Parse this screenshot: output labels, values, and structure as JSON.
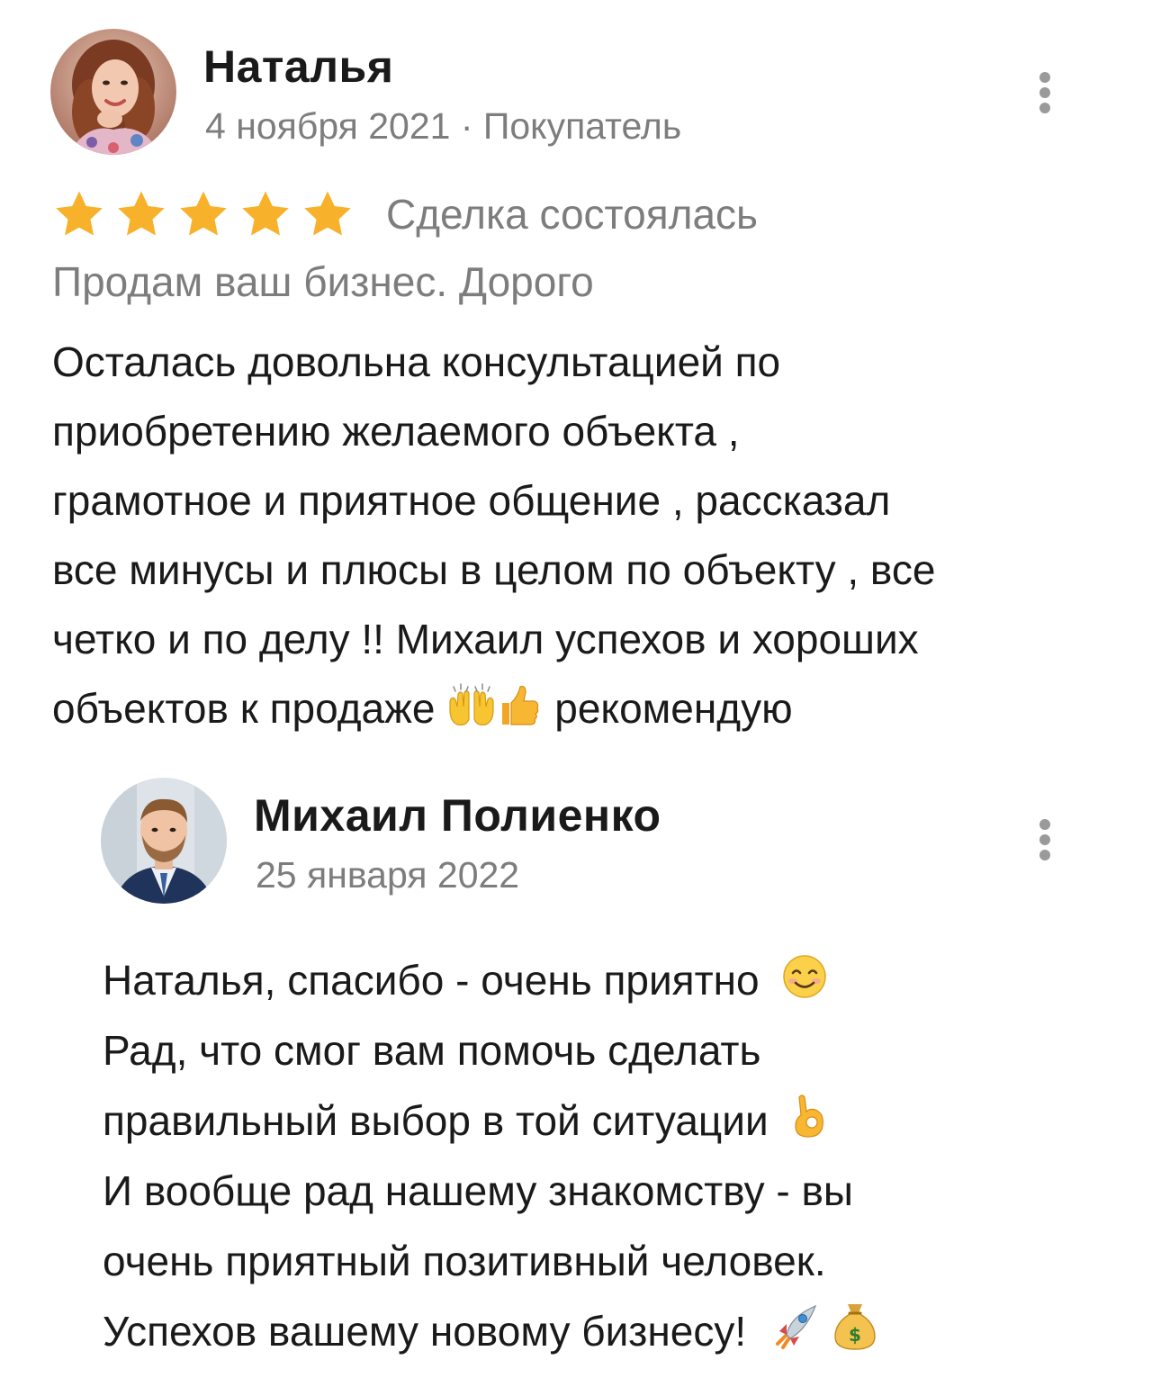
{
  "review": {
    "author_name": "Наталья",
    "meta": "4 ноября 2021 · Покупатель",
    "rating": 5,
    "rating_max": 5,
    "star_color": "#f8b12b",
    "deal_status": "Сделка состоялась",
    "listing_title": "Продам ваш бизнес. Дорого",
    "text_lines": [
      "Осталась довольна консультацией по",
      "приобретению желаемого объекта ,",
      "грамотное и приятное общение , рассказал",
      "все минусы и плюсы в целом по объекту , все",
      "четко и по делу !! Михаил успехов и хороших",
      "объектов к продаже",
      "рекомендую"
    ],
    "emojis": [
      "raising-hands-emoji",
      "thumbs-up-emoji"
    ]
  },
  "reply": {
    "author_name": "Михаил Полиенко",
    "date": "25 января 2022",
    "text_lines": [
      "Наталья, спасибо - очень приятно",
      "Рад, что смог вам помочь сделать",
      "правильный выбор в той ситуации",
      "И вообще рад нашему знакомству - вы",
      "очень приятный позитивный человек.",
      "Успехов вашему новому бизнесу!"
    ],
    "emojis": [
      "smiling-face-emoji",
      "ok-hand-emoji",
      "rocket-emoji",
      "money-bag-emoji"
    ]
  },
  "colors": {
    "text": "#1a1a1a",
    "secondary_text": "#7d7d7d",
    "kebab": "#9a9a9a",
    "background": "#ffffff"
  }
}
